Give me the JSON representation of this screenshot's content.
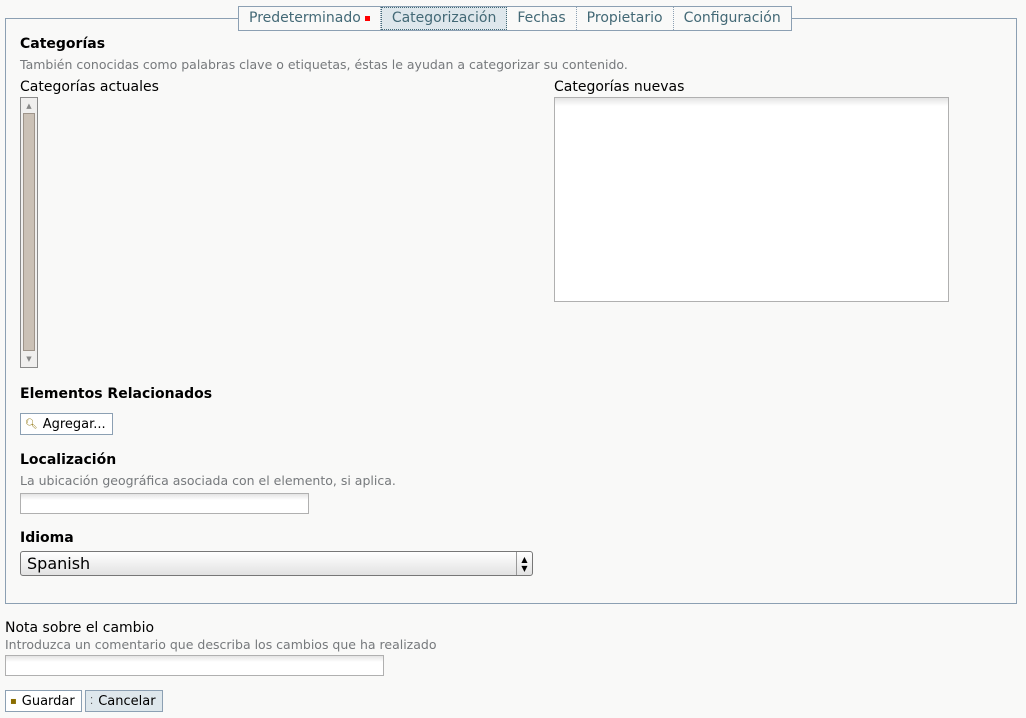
{
  "tabs": [
    {
      "label": "Predeterminado",
      "required": true,
      "selected": false
    },
    {
      "label": "Categorización",
      "selected": true
    },
    {
      "label": "Fechas",
      "selected": false
    },
    {
      "label": "Propietario",
      "selected": false
    },
    {
      "label": "Configuración",
      "selected": false
    }
  ],
  "categories": {
    "title": "Categorías",
    "help": "También conocidas como palabras clave o etiquetas, éstas le ayudan a categorizar su contenido.",
    "current_label": "Categorías actuales",
    "new_label": "Categorías nuevas",
    "new_value": ""
  },
  "related": {
    "title": "Elementos Relacionados",
    "add_button": "Agregar..."
  },
  "location": {
    "title": "Localización",
    "help": "La ubicación geográfica asociada con el elemento, si aplica.",
    "value": ""
  },
  "language": {
    "title": "Idioma",
    "selected": "Spanish"
  },
  "change_note": {
    "title": "Nota sobre el cambio",
    "help": "Introduzca un comentario que describa los cambios que ha realizado",
    "value": ""
  },
  "actions": {
    "save": "Guardar",
    "cancel": "Cancelar"
  },
  "colors": {
    "border": "#8ca0b3",
    "tab_text": "#436976",
    "selected_tab_bg": "#dee7ec",
    "required_marker": "#ff0000",
    "help_text": "#76797c"
  },
  "icons": {
    "add_button": "magnifier-icon",
    "save_button": "save-icon",
    "cancel_button": "cancel-icon"
  }
}
